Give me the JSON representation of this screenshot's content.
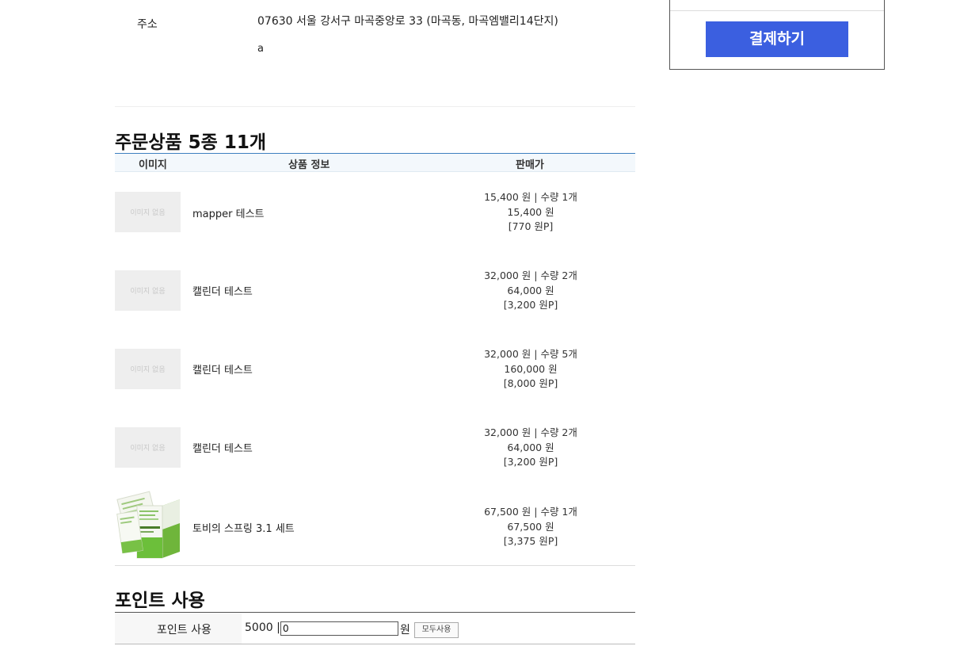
{
  "address": {
    "label": "주소",
    "line1": "07630 서울 강서구 마곡중앙로 33 (마곡동, 마곡엠밸리14단지)",
    "line2": "a"
  },
  "order": {
    "title": "주문상품 5종 11개",
    "columns": {
      "image": "이미지",
      "info": "상품 정보",
      "price": "판매가"
    },
    "no_image_text": "이미지 없음",
    "items": [
      {
        "name": "mapper 테스트",
        "unit_qty": "15,400 원 | 수량 1개",
        "total": "15,400 원",
        "points": "[770 원P]",
        "has_image": false
      },
      {
        "name": "캘린더 테스트",
        "unit_qty": "32,000 원 | 수량 2개",
        "total": "64,000 원",
        "points": "[3,200 원P]",
        "has_image": false
      },
      {
        "name": "캘린더 테스트",
        "unit_qty": "32,000 원 | 수량 5개",
        "total": "160,000 원",
        "points": "[8,000 원P]",
        "has_image": false
      },
      {
        "name": "캘린더 테스트",
        "unit_qty": "32,000 원 | 수량 2개",
        "total": "64,000 원",
        "points": "[3,200 원P]",
        "has_image": false
      },
      {
        "name": "토비의 스프링 3.1 세트",
        "unit_qty": "67,500 원 | 수량 1개",
        "total": "67,500 원",
        "points": "[3,375 원P]",
        "has_image": true
      }
    ]
  },
  "points": {
    "title": "포인트 사용",
    "label": "포인트 사용",
    "available": "5000 |",
    "input_value": "0",
    "unit": "원",
    "use_all_label": "모두사용"
  },
  "payment": {
    "button_label": "결제하기",
    "button_color": "#3b5fe0"
  }
}
